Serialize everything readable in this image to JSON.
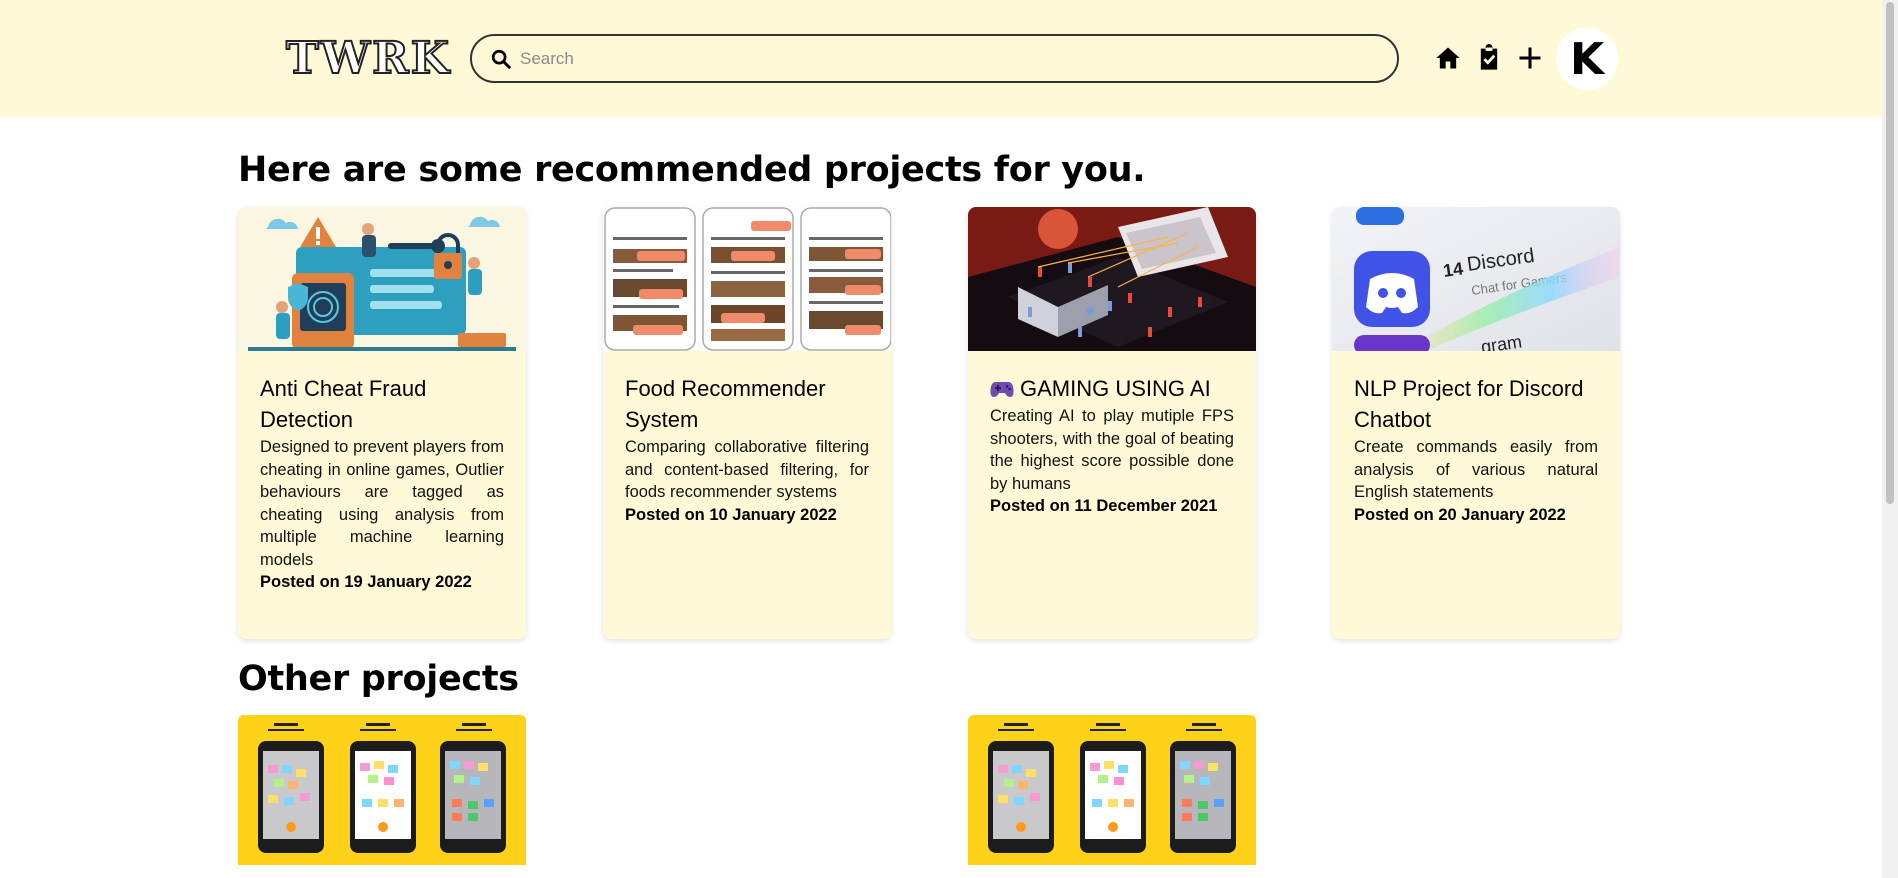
{
  "header": {
    "logo_text": "TWRK",
    "search_placeholder": "Search",
    "avatar_letter": "K",
    "icons": [
      "home-icon",
      "clipboard-check-icon",
      "plus-icon"
    ],
    "background": "#fff9d8"
  },
  "recommended": {
    "heading": "Here are some recommended projects for you.",
    "cards": [
      {
        "title": "Anti Cheat Fraud Detection",
        "description": "Designed to prevent players from cheating in online games, Outlier behaviours are tagged as cheating using analysis from multiple machine learning models",
        "date": "Posted on 19 January 2022",
        "thumb": "security-illustration"
      },
      {
        "title": "Food Recommender System",
        "description": "Comparing collaborative filtering and content-based filtering, for foods recommender systems",
        "date": "Posted on 10 January 2022",
        "thumb": "phone-screens"
      },
      {
        "title_emoji": "gamepad-icon",
        "title": "GAMING USING AI",
        "description": "Creating AI to play mutiple FPS shooters, with the goal of beating the highest score possible done by humans",
        "date": "Posted on 11 December 2021",
        "thumb": "isometric-game-scene"
      },
      {
        "title": "NLP Project for Discord Chatbot",
        "description": "Create commands easily from analysis of various natural English statements",
        "date": "Posted on 20 January 2022",
        "thumb": "discord-app-closeup",
        "thumb_text": {
          "count": "14",
          "name": "Discord",
          "tagline": "Chat for Gamers",
          "partial": "gram"
        }
      }
    ]
  },
  "other": {
    "heading": "Other projects",
    "cards": [
      {
        "thumb": "sticky-notes-phones",
        "accent": "#ffd21a"
      },
      {
        "thumb": "sticky-notes-phones",
        "accent": "#ffd21a"
      }
    ]
  },
  "colors": {
    "card_bg": "#fff9d8",
    "accent_yellow": "#ffd21a",
    "discord_blurple": "#5865f2",
    "food_tag": "#ef8a6b"
  }
}
